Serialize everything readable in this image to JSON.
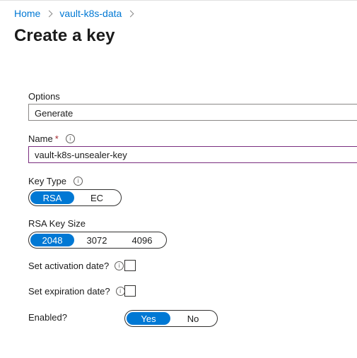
{
  "breadcrumb": {
    "home": "Home",
    "vault": "vault-k8s-data"
  },
  "page_title": "Create a key",
  "info_glyph": "i",
  "form": {
    "options": {
      "label": "Options",
      "value": "Generate"
    },
    "name": {
      "label": "Name",
      "required_mark": "*",
      "value": "vault-k8s-unsealer-key"
    },
    "key_type": {
      "label": "Key Type",
      "options": [
        "RSA",
        "EC"
      ],
      "selected": "RSA"
    },
    "rsa_key_size": {
      "label": "RSA Key Size",
      "options": [
        "2048",
        "3072",
        "4096"
      ],
      "selected": "2048"
    },
    "activation": {
      "label": "Set activation date?",
      "checked": false
    },
    "expiration": {
      "label": "Set expiration date?",
      "checked": false
    },
    "enabled": {
      "label": "Enabled?",
      "options": [
        "Yes",
        "No"
      ],
      "selected": "Yes"
    }
  },
  "colors": {
    "accent": "#0078d4",
    "focus_border": "#7a2e7f",
    "required": "#a4262c"
  }
}
